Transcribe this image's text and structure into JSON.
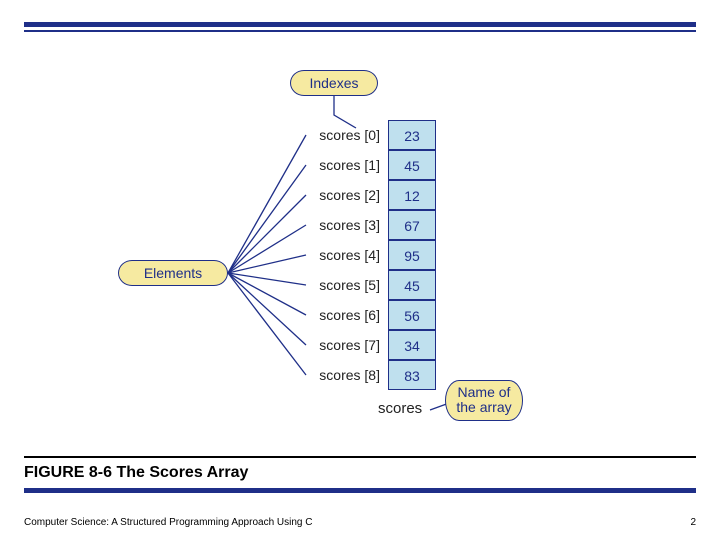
{
  "callouts": {
    "indexes": "Indexes",
    "elements": "Elements",
    "name_line1": "Name of",
    "name_line2": "the array"
  },
  "entries": [
    {
      "label": "scores [0]",
      "value": "23"
    },
    {
      "label": "scores [1]",
      "value": "45"
    },
    {
      "label": "scores [2]",
      "value": "12"
    },
    {
      "label": "scores [3]",
      "value": "67"
    },
    {
      "label": "scores [4]",
      "value": "95"
    },
    {
      "label": "scores [5]",
      "value": "45"
    },
    {
      "label": "scores [6]",
      "value": "56"
    },
    {
      "label": "scores [7]",
      "value": "34"
    },
    {
      "label": "scores [8]",
      "value": "83"
    }
  ],
  "array_name": "scores",
  "caption": {
    "fignum": "FIGURE 8-6",
    "title": "The Scores Array"
  },
  "footer": {
    "book": "Computer Science: A Structured Programming Approach Using C",
    "page": "2"
  }
}
